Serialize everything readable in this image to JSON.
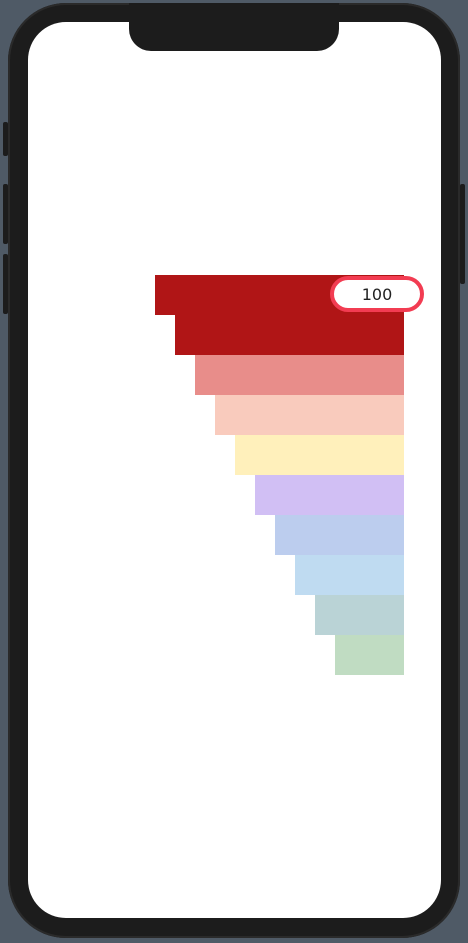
{
  "colors": {
    "background": "#4f5a66",
    "frame": "#1c1c1c",
    "screen": "#ffffff",
    "badge_border": "#f23c52"
  },
  "badge": {
    "value": "100"
  },
  "bars": [
    {
      "color": "#b01516"
    },
    {
      "color": "#b01516"
    },
    {
      "color": "#e88d8a"
    },
    {
      "color": "#f9cbbd"
    },
    {
      "color": "#fff0bb"
    },
    {
      "color": "#d1bff4"
    },
    {
      "color": "#bccdee"
    },
    {
      "color": "#bfdbf1"
    },
    {
      "color": "#bad3d6"
    },
    {
      "color": "#c0dcc2"
    }
  ]
}
